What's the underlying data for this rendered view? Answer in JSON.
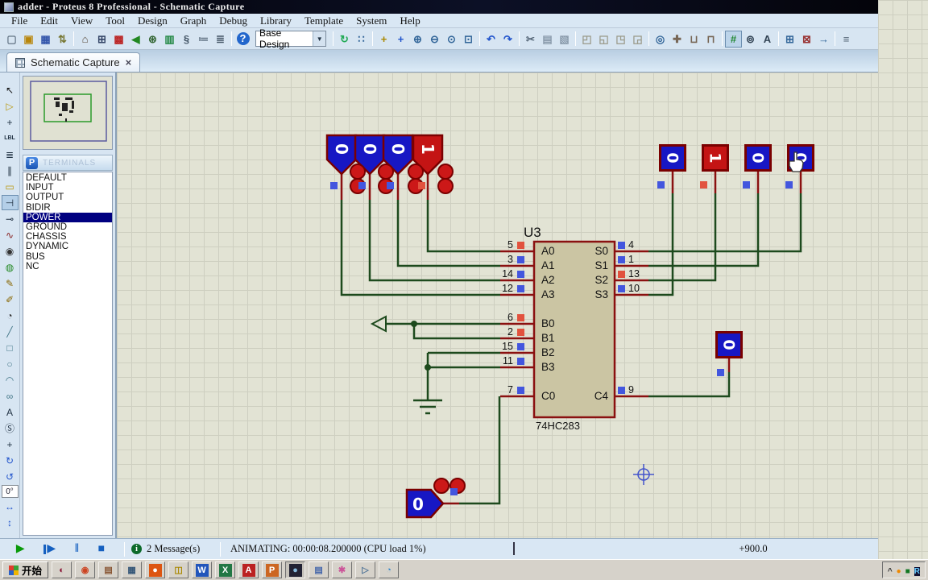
{
  "window": {
    "title": "adder - Proteus 8 Professional - Schematic Capture"
  },
  "menu": {
    "items": [
      "File",
      "Edit",
      "View",
      "Tool",
      "Design",
      "Graph",
      "Debug",
      "Library",
      "Template",
      "System",
      "Help"
    ]
  },
  "toolbar": {
    "design_selector": {
      "value": "Base Design",
      "arrow": "▼"
    },
    "icons_a": [
      {
        "g": "▢",
        "n": "new-project",
        "c": "#667788"
      },
      {
        "g": "▣",
        "n": "open-project",
        "c": "#b8860b"
      },
      {
        "g": "▦",
        "n": "save-project",
        "c": "#3355aa"
      },
      {
        "g": "⇅",
        "n": "import-project",
        "c": "#777733"
      },
      {
        "sep": 1,
        "n": "separator",
        "i": "false"
      },
      {
        "g": "⌂",
        "n": "home-page",
        "c": "#554433"
      },
      {
        "g": "⊞",
        "n": "schematic-capture",
        "c": "#334466"
      },
      {
        "g": "▩",
        "n": "pcb-layout",
        "c": "#bb2222"
      },
      {
        "g": "◀",
        "n": "3d-visualizer",
        "c": "#228822"
      },
      {
        "g": "⊛",
        "n": "gerber-viewer",
        "c": "#336633"
      },
      {
        "g": "▥",
        "n": "design-explorer",
        "c": "#228844"
      },
      {
        "g": "§",
        "n": "source-code",
        "c": "#445566"
      },
      {
        "g": "≔",
        "n": "simulation-timeline",
        "c": "#667788"
      },
      {
        "g": "≣",
        "n": "bill-of-materials",
        "c": "#445566"
      },
      {
        "sep": 1,
        "n": "separator",
        "i": "false"
      },
      {
        "g": "?",
        "n": "help",
        "c": "#ffffff",
        "bg": "#2266cc"
      }
    ],
    "icons_b": [
      {
        "sep": 1,
        "n": "separator",
        "i": "false"
      },
      {
        "g": "↻",
        "n": "redraw",
        "c": "#22aa55"
      },
      {
        "g": "∷",
        "n": "toggle-grid",
        "c": "#336699"
      },
      {
        "sep": 1,
        "n": "separator",
        "i": "false"
      },
      {
        "g": "+",
        "n": "origin",
        "c": "#aa8800"
      },
      {
        "g": "+",
        "n": "pan",
        "c": "#2255cc"
      },
      {
        "g": "⊕",
        "n": "zoom-in",
        "c": "#336699"
      },
      {
        "g": "⊖",
        "n": "zoom-out",
        "c": "#336699"
      },
      {
        "g": "⊙",
        "n": "zoom-all",
        "c": "#336699"
      },
      {
        "g": "⊡",
        "n": "zoom-area",
        "c": "#336699"
      },
      {
        "sep": 1,
        "n": "separator",
        "i": "false"
      },
      {
        "g": "↶",
        "n": "undo",
        "c": "#2255cc"
      },
      {
        "g": "↷",
        "n": "redo",
        "c": "#2255cc"
      },
      {
        "sep": 1,
        "n": "separator",
        "i": "false"
      },
      {
        "g": "✂",
        "n": "cut",
        "c": "#556677"
      },
      {
        "g": "▤",
        "n": "copy",
        "c": "#8899aa"
      },
      {
        "g": "▧",
        "n": "paste",
        "c": "#8899aa"
      },
      {
        "sep": 1,
        "n": "separator",
        "i": "false"
      },
      {
        "g": "◰",
        "n": "block-copy",
        "c": "#9a9a8a"
      },
      {
        "g": "◱",
        "n": "block-move",
        "c": "#9a9a8a"
      },
      {
        "g": "◳",
        "n": "block-rotate",
        "c": "#9a9a8a"
      },
      {
        "g": "◲",
        "n": "block-delete",
        "c": "#9a9a8a"
      },
      {
        "sep": 1,
        "n": "separator",
        "i": "false"
      },
      {
        "g": "◎",
        "n": "pick-parts",
        "c": "#336699"
      },
      {
        "g": "✚",
        "n": "make-device",
        "c": "#776655"
      },
      {
        "g": "⊔",
        "n": "packaging-tool",
        "c": "#776655"
      },
      {
        "g": "⊓",
        "n": "decompose",
        "c": "#776655"
      },
      {
        "sep": 1,
        "n": "separator",
        "i": "false"
      },
      {
        "g": "#",
        "n": "wire-autorouter",
        "c": "#228833",
        "sel": 1
      },
      {
        "g": "⊚",
        "n": "search-tag",
        "c": "#334455"
      },
      {
        "g": "A",
        "n": "property-assignment-tool",
        "c": "#334455"
      },
      {
        "sep": 1,
        "n": "separator",
        "i": "false"
      },
      {
        "g": "⊞",
        "n": "new-sheet",
        "c": "#336699"
      },
      {
        "g": "⊠",
        "n": "remove-sheet",
        "c": "#993333"
      },
      {
        "g": "→",
        "n": "goto-sheet",
        "c": "#336699"
      },
      {
        "sep": 1,
        "n": "separator",
        "i": "false"
      },
      {
        "g": "≡",
        "n": "design-notes",
        "c": "#556677"
      }
    ]
  },
  "tab": {
    "label": "Schematic Capture",
    "close": "×"
  },
  "left_toolbar": {
    "tools": [
      {
        "g": "↖",
        "n": "selection-mode",
        "c": "#111111"
      },
      {
        "g": "▷",
        "n": "component-mode",
        "c": "#b8960b"
      },
      {
        "g": "+",
        "n": "junction-dot-mode",
        "c": "#223344"
      },
      {
        "g": "LBL",
        "n": "wire-label-mode",
        "c": "#223344"
      },
      {
        "g": "≣",
        "n": "text-script-mode",
        "c": "#223344"
      },
      {
        "g": "∥",
        "n": "buses-mode",
        "c": "#223344"
      },
      {
        "g": "▭",
        "n": "subcircuit-mode",
        "c": "#b8960b"
      },
      {
        "g": "⊣",
        "n": "terminals-mode",
        "c": "#223344",
        "sel": 1
      },
      {
        "g": "⊸",
        "n": "device-pins-mode",
        "c": "#223344"
      },
      {
        "g": "∿",
        "n": "graph-mode",
        "c": "#882222"
      },
      {
        "g": "◉",
        "n": "tape-recorder-mode",
        "c": "#333333"
      },
      {
        "g": "◍",
        "n": "generator-mode",
        "c": "#228822"
      },
      {
        "g": "✎",
        "n": "voltage-probe-mode",
        "c": "#886600"
      },
      {
        "g": "✐",
        "n": "current-probe-mode",
        "c": "#886600"
      },
      {
        "g": "◔",
        "n": "virtual-instruments-mode",
        "c": "#333333"
      },
      {
        "g": "╱",
        "n": "2d-line",
        "c": "#447788"
      },
      {
        "g": "□",
        "n": "2d-box",
        "c": "#447788"
      },
      {
        "g": "○",
        "n": "2d-circle",
        "c": "#447788"
      },
      {
        "g": "◠",
        "n": "2d-arc",
        "c": "#447788"
      },
      {
        "g": "∞",
        "n": "2d-path",
        "c": "#447788"
      },
      {
        "g": "A",
        "n": "2d-text",
        "c": "#223344"
      },
      {
        "g": "Ⓢ",
        "n": "2d-symbol",
        "c": "#223344"
      },
      {
        "g": "+",
        "n": "2d-marker",
        "c": "#223344"
      },
      {
        "g": "↻",
        "n": "rotate-clockwise",
        "c": "#2255cc"
      },
      {
        "g": "↺",
        "n": "rotate-anticlockwise",
        "c": "#2255cc"
      },
      {
        "g": "0°",
        "n": "rotation-angle",
        "box": 1
      },
      {
        "g": "↔",
        "n": "flip-horizontal",
        "c": "#2255cc"
      },
      {
        "g": "↕",
        "n": "flip-vertical",
        "c": "#2255cc"
      }
    ]
  },
  "object_selector": {
    "pick_button": "P",
    "title": "TERMINALS",
    "items": [
      {
        "label": "DEFAULT"
      },
      {
        "label": "INPUT"
      },
      {
        "label": "OUTPUT"
      },
      {
        "label": "BIDIR"
      },
      {
        "label": "POWER",
        "sel": 1
      },
      {
        "label": "GROUND"
      },
      {
        "label": "CHASSIS"
      },
      {
        "label": "DYNAMIC"
      },
      {
        "label": "BUS"
      },
      {
        "label": "NC"
      }
    ]
  },
  "colors": {
    "logic_low": "#1717c4",
    "logic_high": "#c41414",
    "wire": "#1d4a1d",
    "pin": "#8a1010",
    "chip_body": "#cbc5a3",
    "chip_border": "#8a1010",
    "device_border": "#7a0000"
  },
  "schematic": {
    "chip": {
      "ref": "U3",
      "part": "74HC283",
      "left_pins": [
        {
          "num": "5",
          "label": "A0",
          "state": "high"
        },
        {
          "num": "3",
          "label": "A1",
          "state": "low"
        },
        {
          "num": "14",
          "label": "A2",
          "state": "low"
        },
        {
          "num": "12",
          "label": "A3",
          "state": "low"
        },
        {
          "num": "6",
          "label": "B0",
          "state": "high"
        },
        {
          "num": "2",
          "label": "B1",
          "state": "high"
        },
        {
          "num": "15",
          "label": "B2",
          "state": "low"
        },
        {
          "num": "11",
          "label": "B3",
          "state": "low"
        },
        {
          "num": "7",
          "label": "C0",
          "state": "low"
        }
      ],
      "right_pins": [
        {
          "num": "4",
          "label": "S0",
          "state": "low"
        },
        {
          "num": "1",
          "label": "S1",
          "state": "low"
        },
        {
          "num": "13",
          "label": "S2",
          "state": "high"
        },
        {
          "num": "10",
          "label": "S3",
          "state": "low"
        },
        {
          "num": "9",
          "label": "C4",
          "state": "low"
        }
      ]
    },
    "input_flags": [
      {
        "value": "0",
        "state": "low"
      },
      {
        "value": "0",
        "state": "low"
      },
      {
        "value": "0",
        "state": "low"
      },
      {
        "value": "1",
        "state": "high"
      }
    ],
    "output_probes": [
      {
        "value": "0",
        "state": "low"
      },
      {
        "value": "1",
        "state": "high"
      },
      {
        "value": "0",
        "state": "low"
      },
      {
        "value": "0",
        "state": "low"
      }
    ],
    "carry_in": {
      "value": "0",
      "state": "low"
    },
    "carry_out": {
      "value": "0",
      "state": "low"
    }
  },
  "status_bar": {
    "controls": {
      "play": "▶",
      "step": "▶",
      "pause": "‖",
      "stop": "■"
    },
    "info_icon": "i",
    "messages": "2 Message(s)",
    "animating": "ANIMATING: 00:00:08.200000 (CPU load 1%)",
    "coordinate": "+900.0"
  },
  "taskbar": {
    "start": "开始",
    "items": [
      {
        "g": "◐",
        "n": "taskbar-media-player",
        "c": "#881133"
      },
      {
        "g": "◉",
        "n": "taskbar-chrome",
        "c": "#cc4422"
      },
      {
        "g": "▤",
        "n": "taskbar-ebook",
        "c": "#885533"
      },
      {
        "g": "▦",
        "n": "taskbar-remote-desktop",
        "c": "#335577"
      },
      {
        "g": "●",
        "n": "taskbar-thunder",
        "c": "#ffffff",
        "bg": "#dd5511"
      },
      {
        "g": "◫",
        "n": "taskbar-folder",
        "c": "#aa8800"
      },
      {
        "g": "W",
        "n": "taskbar-word",
        "c": "#ffffff",
        "bg": "#2255bb"
      },
      {
        "g": "X",
        "n": "taskbar-excel",
        "c": "#ffffff",
        "bg": "#227744"
      },
      {
        "g": "A",
        "n": "taskbar-acrobat",
        "c": "#ffffff",
        "bg": "#bb2222"
      },
      {
        "g": "P",
        "n": "taskbar-powerpoint",
        "c": "#ffffff",
        "bg": "#cc6622"
      },
      {
        "g": "●",
        "n": "taskbar-recorder",
        "c": "#88bbdd",
        "bg": "#222233",
        "active": 1
      },
      {
        "g": "▤",
        "n": "taskbar-notepad",
        "c": "#4466aa"
      },
      {
        "g": "✱",
        "n": "taskbar-photos",
        "c": "#cc5599"
      },
      {
        "g": "▷",
        "n": "taskbar-media",
        "c": "#557799"
      },
      {
        "g": "◔",
        "n": "taskbar-browser",
        "c": "#3388cc"
      }
    ],
    "tray": [
      {
        "g": "^",
        "n": "tray-expand",
        "c": "#333333"
      },
      {
        "g": "●",
        "n": "tray-update",
        "c": "#ee8800"
      },
      {
        "g": "■",
        "n": "tray-safety",
        "c": "#117722"
      },
      {
        "g": "R",
        "n": "tray-recorder",
        "c": "#66ccff",
        "bg": "#111133"
      }
    ]
  }
}
